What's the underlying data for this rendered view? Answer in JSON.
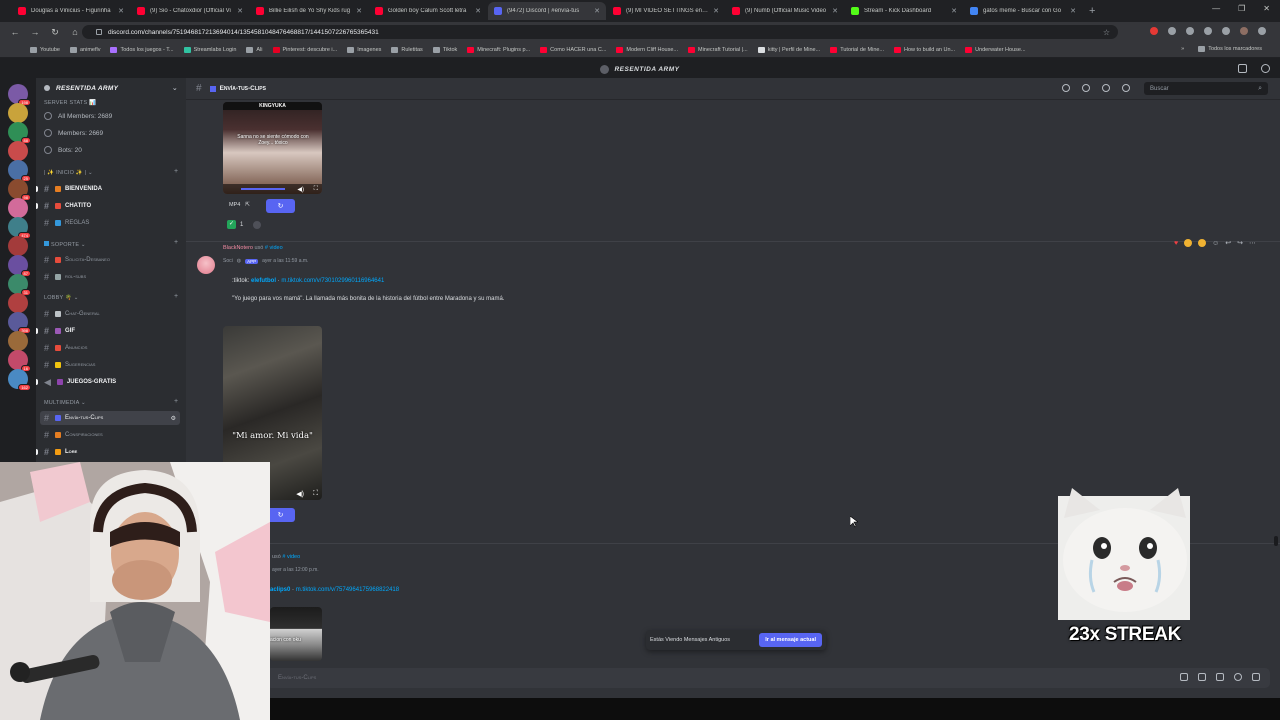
{
  "browser": {
    "tabs": [
      {
        "title": "Douglas a Vinicius - Figurinha",
        "color": "#ff0033"
      },
      {
        "title": "(9) Sio - Chatoxdior (Official Vi",
        "color": "#ff0033"
      },
      {
        "title": "Billie Eilish de Yo Shy Kids rug",
        "color": "#ff0033"
      },
      {
        "title": "Golden boy Calum Scott letra",
        "color": "#ff0033"
      },
      {
        "title": "(9472) Discord | #envía-tus",
        "color": "#5865f2",
        "active": true
      },
      {
        "title": "(9) MI VIDEO SETTINGS en CS",
        "color": "#ff0033"
      },
      {
        "title": "(9) Numb (Official Music Video",
        "color": "#ff0033"
      },
      {
        "title": "Stream - Kick Dashboard",
        "color": "#53fc18"
      },
      {
        "title": "gatos meme - Buscar con Go",
        "color": "#4285f4"
      }
    ],
    "url": "discord.com/channels/751946817213694014/1354581048476468817/1441507226765365431",
    "bookmarks": [
      {
        "label": "Youtube",
        "color": "#9aa0a6"
      },
      {
        "label": "animeflv",
        "color": "#9aa0a6"
      },
      {
        "label": "Todos los juegos - T...",
        "color": "#a970ff"
      },
      {
        "label": "Streamlabs Login",
        "color": "#31c3a2"
      },
      {
        "label": "Ali",
        "color": "#9aa0a6"
      },
      {
        "label": "Pinterest: descubre i...",
        "color": "#e60023"
      },
      {
        "label": "Imagenes",
        "color": "#9aa0a6"
      },
      {
        "label": "Ruletitas",
        "color": "#9aa0a6"
      },
      {
        "label": "Tiktok",
        "color": "#9aa0a6"
      },
      {
        "label": "Minecraft: Plugins p...",
        "color": "#ff0033"
      },
      {
        "label": "Como HACER una C...",
        "color": "#ff0033"
      },
      {
        "label": "Modern Cliff House...",
        "color": "#ff0033"
      },
      {
        "label": "Minecraft Tutorial |...",
        "color": "#ff0033"
      },
      {
        "label": "kitty | Perfil de Mine...",
        "color": "#dbdee1"
      },
      {
        "label": "Tutorial de Mine...",
        "color": "#ff0033"
      },
      {
        "label": "How to build an Un...",
        "color": "#ff0033"
      },
      {
        "label": "Underwater House...",
        "color": "#ff0033"
      }
    ],
    "all_bookmarks": "Todos los marcadores"
  },
  "app": {
    "title": "RESENTIDA ARMY",
    "server_name": "RESENTIDA ARMY"
  },
  "sidebar": {
    "server_stats_cat": "SERVER STATS 📊",
    "stats": [
      {
        "label": "All Members: 2689"
      },
      {
        "label": "Members: 2669"
      },
      {
        "label": "Bots: 20"
      }
    ],
    "cat_inicio": "| ✨ INICIO ✨ |",
    "cat_soporte": "SOPORTE",
    "cat_lobby": "LOBBY 🌴",
    "cat_multimedia": "MULTIMEDIA",
    "channels": {
      "bienvenida": "BIENVENIDA",
      "chatito": "CHATITO",
      "reglas": "REGLAS",
      "solicita": "Solicita-Desbaneo",
      "rolsubs": "rol-subs",
      "chatgeneral": "Chat-General",
      "gif": "GIF",
      "anuncios": "Anuncios",
      "sugerencias": "Sugerencias",
      "juegos": "JUEGOS-GRATIS",
      "envia": "Envía-tus-Clips",
      "conspiraciones": "Conspiraciones",
      "lore": "Lore"
    }
  },
  "rail_badges": [
    "198",
    "88",
    "25",
    "98",
    "474",
    "87",
    "31",
    "398",
    "16",
    "162"
  ],
  "channel": {
    "name": "Envía-tus-Clips",
    "search_placeholder": "Buscar"
  },
  "messages": {
    "first": {
      "thumb_caption_top": "KINGYUKA",
      "thumb_caption": "Sanna no se siente cómodo con Zoey... tóxico",
      "mp4_label": "MP4",
      "reaction_count": "1"
    },
    "second": {
      "reply_user": "BlackNotero",
      "reply_used": "usó",
      "reply_cmd": "# video",
      "author": "Soci",
      "app_tag": "APP",
      "time": "ayer a las 11:59 a.m.",
      "tiktok_prefix": ":tiktok:",
      "tiktok_user": "elefutbol",
      "tiktok_link": "m.tiktok.com/v/7301029960116964641",
      "text": "\"Yo juego para vos mamá\". La llamada más bonita de la historia del fútbol entre Maradona y su mamá.",
      "video_caption": "\"Mi amor. Mi vida\""
    },
    "third": {
      "reply_used": "usó",
      "reply_cmd": "# video",
      "time": "ayer a las 12:00 p.m.",
      "tiktok_user": "aclips0",
      "tiktok_link": "m.tiktok.com/v/7574964175968822418",
      "thumb_caption": "acion con oku"
    }
  },
  "banner": {
    "text": "Estás Viendo Mensajes Antiguos",
    "button": "Ir al mensaje actual"
  },
  "composer": {
    "placeholder": "Envía-tus-Clips"
  },
  "overlay": {
    "streak": "23x STREAK"
  }
}
